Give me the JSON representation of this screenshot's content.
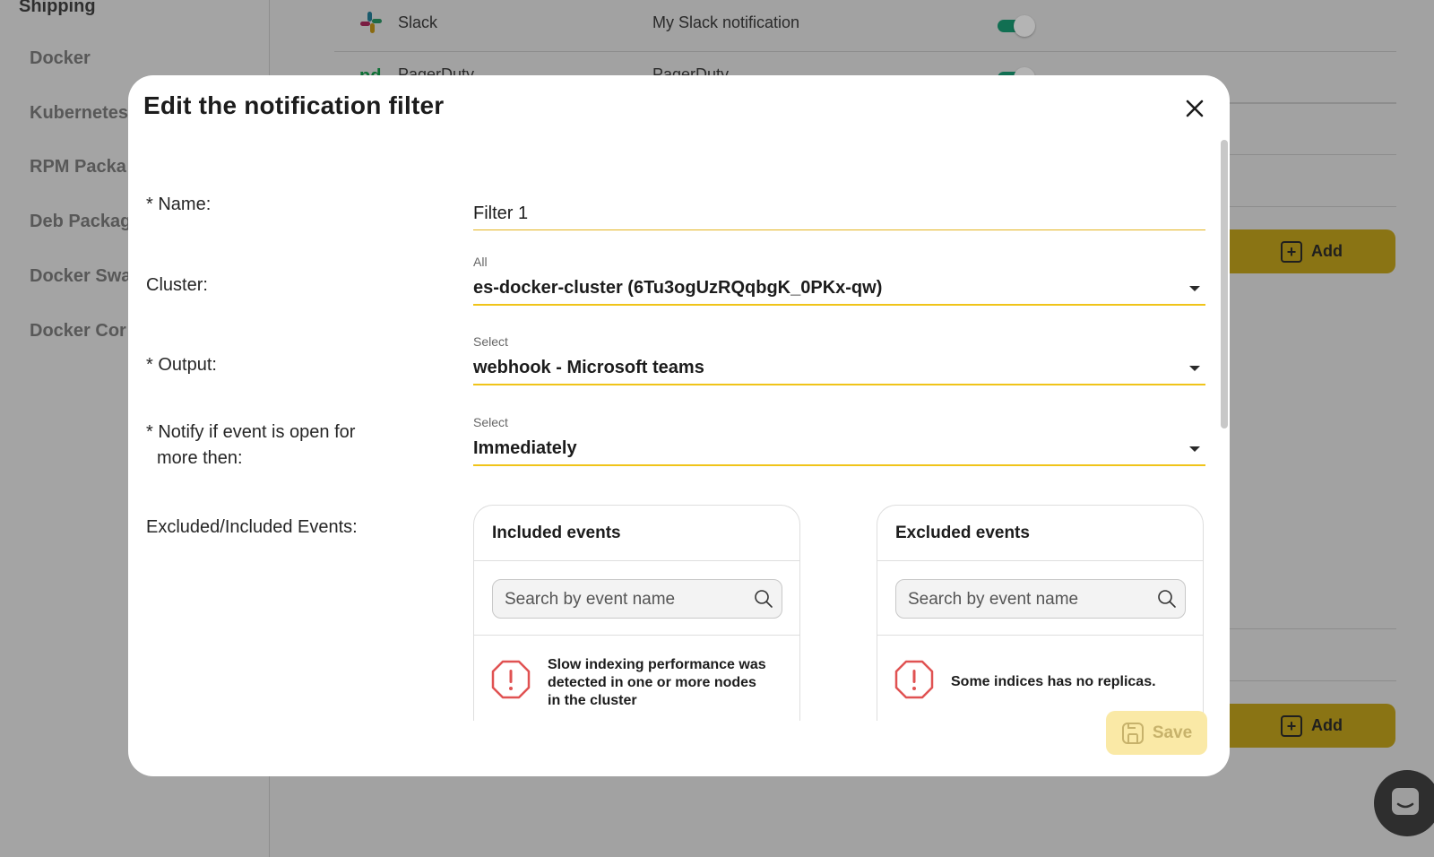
{
  "background": {
    "sidebar": {
      "section_title": "Shipping",
      "items": [
        {
          "label": "Docker"
        },
        {
          "label": "Kubernetes"
        },
        {
          "label": "RPM Packa"
        },
        {
          "label": "Deb Packag"
        },
        {
          "label": "Docker Swa"
        },
        {
          "label": "Docker Cor"
        }
      ]
    },
    "notifications": [
      {
        "name": "Slack",
        "description": "My Slack notification",
        "enabled": true
      },
      {
        "name": "PagerDuty",
        "description": "PagerDuty",
        "enabled": true
      }
    ],
    "add_label": "Add"
  },
  "modal": {
    "title": "Edit the notification filter",
    "fields": {
      "name": {
        "label": "* Name:",
        "value": "Filter 1"
      },
      "cluster": {
        "label": "Cluster:",
        "caption": "All",
        "value": "es-docker-cluster (6Tu3ogUzRQqbgK_0PKx-qw)"
      },
      "output": {
        "label": "* Output:",
        "caption": "Select",
        "value": "webhook - Microsoft teams"
      },
      "notify": {
        "label_line1": "* Notify if event is open for",
        "label_line2": "more then:",
        "caption": "Select",
        "value": "Immediately"
      },
      "events": {
        "label": "Excluded/Included Events:"
      }
    },
    "included": {
      "title": "Included events",
      "search_placeholder": "Search by event name",
      "items": [
        {
          "text": "Slow indexing performance was detected in one or more nodes in the cluster"
        }
      ]
    },
    "excluded": {
      "title": "Excluded events",
      "search_placeholder": "Search by event name",
      "items": [
        {
          "text": "Some indices has no replicas."
        }
      ]
    },
    "save_label": "Save"
  },
  "colors": {
    "accent": "#f0c419",
    "save_disabled_bg": "#fae9a6",
    "warning": "#e05252",
    "toggle_on": "#116f52"
  }
}
